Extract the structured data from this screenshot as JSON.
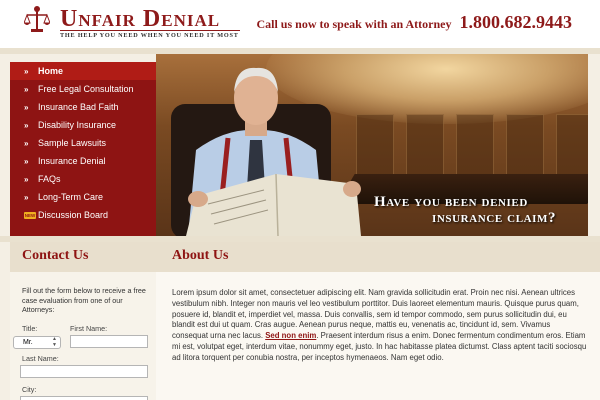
{
  "header": {
    "logo_text": "Unfair Denial",
    "tagline": "THE HELP YOU NEED WHEN YOU NEED IT MOST",
    "call_label": "Call us now to speak with an Attorney",
    "phone": "1.800.682.9443",
    "logo_icon": "scales-of-justice-icon",
    "accent_color": "#8e1a1a"
  },
  "nav": {
    "items": [
      {
        "label": "Home",
        "icon": "chevron-right-icon",
        "active": true
      },
      {
        "label": "Free Legal Consultation",
        "icon": "chevron-right-icon"
      },
      {
        "label": "Insurance Bad Faith",
        "icon": "chevron-right-icon"
      },
      {
        "label": "Disability Insurance",
        "icon": "chevron-right-icon"
      },
      {
        "label": "Sample Lawsuits",
        "icon": "chevron-right-icon"
      },
      {
        "label": "Insurance Denial",
        "icon": "chevron-right-icon"
      },
      {
        "label": "FAQs",
        "icon": "chevron-right-icon"
      },
      {
        "label": "Long-Term Care",
        "icon": "chevron-right-icon"
      },
      {
        "label": "Discussion Board",
        "icon": "new-badge-icon",
        "badge": "NEW"
      }
    ]
  },
  "hero": {
    "line1": "Have you been denied",
    "line2": "insurance claim?"
  },
  "contact": {
    "heading": "Contact Us",
    "intro": "Fill out the form below to receive a free case evaluation from one of our Attorneys:",
    "title_label": "Title:",
    "title_value": "Mr.",
    "first_name_label": "First Name:",
    "last_name_label": "Last Name:",
    "city_label": "City:"
  },
  "about": {
    "heading": "About Us",
    "text_before_link": "Lorem ipsum dolor sit amet, consectetuer adipiscing elit. Nam gravida sollicitudin erat. Proin nec nisi. Aenean ultrices vestibulum nibh. Integer non mauris vel leo vestibulum porttitor. Duis laoreet elementum mauris. Quisque purus quam, posuere id, blandit et, imperdiet vel, massa. Duis convallis, sem id tempor commodo, sem purus sollicitudin dui, eu blandit est dui ut quam. Cras augue. Aenean purus neque, mattis eu, venenatis ac, tincidunt id, sem. Vivamus consequat urna nec lacus.",
    "link_text": "Sed non enim",
    "text_after_link": ". Praesent interdum risus a enim. Donec fermentum condimentum eros. Etiam mi est, volutpat eget, interdum vitae, nonummy eget, justo. In hac habitasse platea dictumst. Class aptent taciti sociosqu ad litora torquent per conubia nostra, per inceptos hymenaeos. Nam eget odio."
  }
}
